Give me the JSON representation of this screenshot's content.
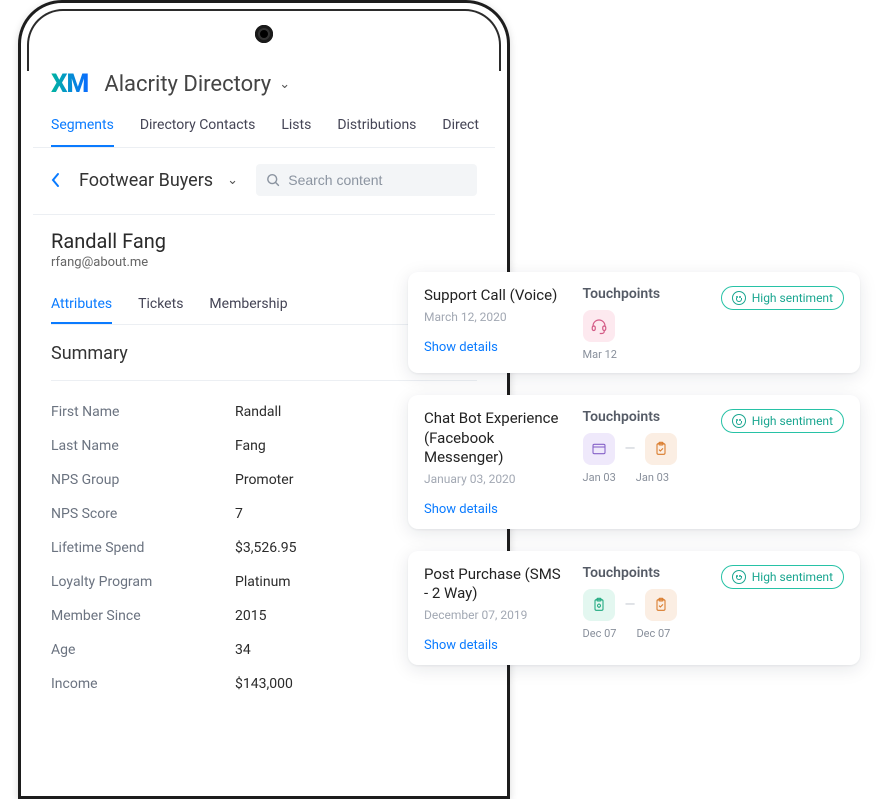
{
  "header": {
    "logo_text": "XM",
    "title": "Alacrity Directory"
  },
  "tabs": [
    "Segments",
    "Directory Contacts",
    "Lists",
    "Distributions",
    "Direct"
  ],
  "active_tab_index": 0,
  "segment": {
    "name": "Footwear Buyers"
  },
  "search": {
    "placeholder": "Search content"
  },
  "contact": {
    "name": "Randall Fang",
    "email": "rfang@about.me",
    "sub_tabs": [
      "Attributes",
      "Tickets",
      "Membership"
    ],
    "active_sub_tab_index": 0
  },
  "summary": {
    "title": "Summary",
    "rows": [
      {
        "label": "First Name",
        "value": "Randall"
      },
      {
        "label": "Last Name",
        "value": "Fang"
      },
      {
        "label": "NPS Group",
        "value": "Promoter"
      },
      {
        "label": "NPS Score",
        "value": "7"
      },
      {
        "label": "Lifetime Spend",
        "value": "$3,526.95"
      },
      {
        "label": "Loyalty Program",
        "value": "Platinum"
      },
      {
        "label": "Member Since",
        "value": "2015"
      },
      {
        "label": "Age",
        "value": "34"
      },
      {
        "label": "Income",
        "value": "$143,000"
      }
    ]
  },
  "cards": [
    {
      "title": "Support Call (Voice)",
      "date": "March 12, 2020",
      "show_details": "Show details",
      "touchpoints_label": "Touchpoints",
      "icons": [
        {
          "name": "headset-icon",
          "color": "pink"
        }
      ],
      "sub_dates": [
        "Mar 12"
      ],
      "sentiment": "High sentiment"
    },
    {
      "title": "Chat Bot Experience (Facebook Messenger)",
      "date": "January 03, 2020",
      "show_details": "Show details",
      "touchpoints_label": "Touchpoints",
      "icons": [
        {
          "name": "window-icon",
          "color": "lav"
        },
        {
          "name": "clipboard-check-icon",
          "color": "peach"
        }
      ],
      "sub_dates": [
        "Jan 03",
        "Jan 03"
      ],
      "sentiment": "High sentiment"
    },
    {
      "title": "Post Purchase (SMS - 2 Way)",
      "date": "December 07, 2019",
      "show_details": "Show details",
      "touchpoints_label": "Touchpoints",
      "icons": [
        {
          "name": "clipboard-gear-icon",
          "color": "mint"
        },
        {
          "name": "clipboard-check-icon",
          "color": "peach"
        }
      ],
      "sub_dates": [
        "Dec 07",
        "Dec 07"
      ],
      "sentiment": "High sentiment"
    }
  ]
}
